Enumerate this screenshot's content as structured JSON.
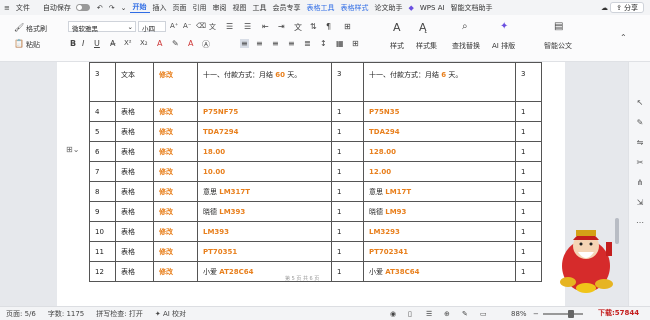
{
  "menu": {
    "file": "文件",
    "autosave": "自动保存",
    "items": [
      "开始",
      "插入",
      "页面",
      "引用",
      "审阅",
      "视图",
      "工具",
      "会员专享"
    ],
    "blue_items": [
      "表格工具",
      "表格样式"
    ],
    "items2": [
      "论文助手"
    ],
    "wps_ai": "WPS AI",
    "assistant": "智能文档助手",
    "share": "分享"
  },
  "ribbon": {
    "format_painter": "格式刷",
    "paste": "粘贴",
    "font_name": "微软雅黑",
    "font_size": "小四",
    "styles": "样式",
    "style_set": "样式集",
    "find_replace": "查找替换",
    "ai_layout": "AI 排版",
    "smart_doc": "智能公文"
  },
  "table": {
    "rows": [
      {
        "no": "3",
        "type": "文本",
        "action": "修改",
        "old_pre": "十一、付款方式：月结 ",
        "old_hl": "60",
        "old_post": " 天。",
        "q1": "3",
        "new_pre": "十一、付款方式：月结 ",
        "new_hl": "6",
        "new_post": " 天。",
        "q2": "3"
      },
      {
        "no": "4",
        "type": "表格",
        "action": "修改",
        "old_pre": "",
        "old_hl": "P75NF75",
        "old_post": "",
        "q1": "1",
        "new_pre": "",
        "new_hl": "P75N35",
        "new_post": "",
        "q2": "1"
      },
      {
        "no": "5",
        "type": "表格",
        "action": "修改",
        "old_pre": "",
        "old_hl": "TDA7294",
        "old_post": "",
        "q1": "1",
        "new_pre": "",
        "new_hl": "TDA294",
        "new_post": "",
        "q2": "1"
      },
      {
        "no": "6",
        "type": "表格",
        "action": "修改",
        "old_pre": "",
        "old_hl": "18.00",
        "old_post": "",
        "q1": "1",
        "new_pre": "",
        "new_hl": "128.00",
        "new_post": "",
        "q2": "1"
      },
      {
        "no": "7",
        "type": "表格",
        "action": "修改",
        "old_pre": "",
        "old_hl": "10.00",
        "old_post": "",
        "q1": "1",
        "new_pre": "",
        "new_hl": "12.00",
        "new_post": "",
        "q2": "1"
      },
      {
        "no": "8",
        "type": "表格",
        "action": "修改",
        "old_pre": "意思 ",
        "old_hl": "LM317T",
        "old_post": "",
        "q1": "1",
        "new_pre": "意思 ",
        "new_hl": "LM17T",
        "new_post": "",
        "q2": "1"
      },
      {
        "no": "9",
        "type": "表格",
        "action": "修改",
        "old_pre": "晓德 ",
        "old_hl": "LM393",
        "old_post": "",
        "q1": "1",
        "new_pre": "晓德 ",
        "new_hl": "LM93",
        "new_post": "",
        "q2": "1"
      },
      {
        "no": "10",
        "type": "表格",
        "action": "修改",
        "old_pre": "",
        "old_hl": "LM393",
        "old_post": "",
        "q1": "1",
        "new_pre": "",
        "new_hl": "LM3293",
        "new_post": "",
        "q2": "1"
      },
      {
        "no": "11",
        "type": "表格",
        "action": "修改",
        "old_pre": "",
        "old_hl": "PT70351",
        "old_post": "",
        "q1": "1",
        "new_pre": "",
        "new_hl": "PT702341",
        "new_post": "",
        "q2": "1"
      },
      {
        "no": "12",
        "type": "表格",
        "action": "修改",
        "old_pre": "小爱 ",
        "old_hl": "AT28C64",
        "old_post": "",
        "q1": "1",
        "new_pre": "小爱 ",
        "new_hl": "AT38C64",
        "new_post": "",
        "q2": "1"
      }
    ],
    "page_footer": "第 5 页 共 6 页"
  },
  "status": {
    "page": "页面: 5/6",
    "words": "字数: 1175",
    "spell": "拼写检查: 打开",
    "ai": "AI 校对",
    "zoom": "88%"
  },
  "mascot_text": "下载:57844",
  "colors": {
    "accent": "#2f6ce5",
    "highlight": "#e87f1c"
  }
}
